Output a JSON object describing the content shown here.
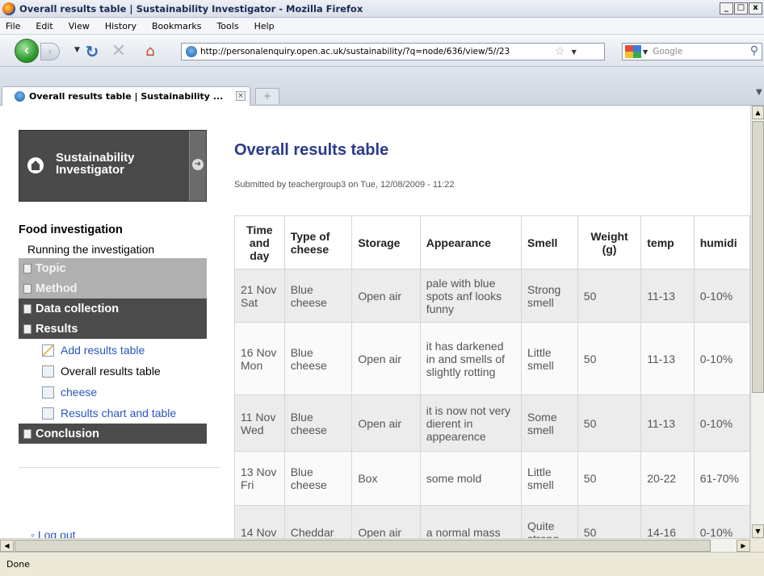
{
  "window": {
    "title": "Overall results table | Sustainability Investigator - Mozilla Firefox",
    "controls": [
      "_",
      "□",
      "x"
    ]
  },
  "menu": [
    "File",
    "Edit",
    "View",
    "History",
    "Bookmarks",
    "Tools",
    "Help"
  ],
  "nav": {
    "url": "http://personalenquiry.open.ac.uk/sustainability/?q=node/636/view/5//23",
    "search_placeholder": "Google"
  },
  "tab": {
    "title": "Overall results table | Sustainability ..."
  },
  "status": "Done",
  "sidebar": {
    "logo_line1": "Sustainability",
    "logo_line2": "Investigator",
    "heading": "Food investigation",
    "subheading": "Running the investigation",
    "items": [
      {
        "label": "Topic"
      },
      {
        "label": "Method"
      },
      {
        "label": "Data collection"
      },
      {
        "label": "Results"
      }
    ],
    "result_links": [
      {
        "label": "Add results table"
      },
      {
        "label": "Overall results table"
      },
      {
        "label": "cheese"
      },
      {
        "label": "Results chart and table"
      }
    ],
    "conclusion": "Conclusion",
    "logout": "Log out"
  },
  "main": {
    "title": "Overall results table",
    "submitted": "Submitted by teachergroup3 on Tue, 12/08/2009 - 11:22",
    "headers": [
      "Time and day",
      "Type of cheese",
      "Storage",
      "Appearance",
      "Smell",
      "Weight (g)",
      "temp",
      "humidi"
    ],
    "rows": [
      {
        "time": "21 Nov Sat",
        "cheese": "Blue cheese",
        "storage": "Open air",
        "appearance": "pale with blue spots anf looks funny",
        "smell": "Strong smell",
        "weight": "50",
        "temp": "11-13",
        "humidity": "0-10%"
      },
      {
        "time": "16 Nov Mon",
        "cheese": "Blue cheese",
        "storage": "Open air",
        "appearance": "it has darkened in and smells of slightly rotting",
        "smell": "Little smell",
        "weight": "50",
        "temp": "11-13",
        "humidity": "0-10%"
      },
      {
        "time": "11 Nov Wed",
        "cheese": "Blue cheese",
        "storage": "Open air",
        "appearance": "it is now not very dierent in appearence",
        "smell": "Some smell",
        "weight": "50",
        "temp": "11-13",
        "humidity": "0-10%"
      },
      {
        "time": "13 Nov Fri",
        "cheese": "Blue cheese",
        "storage": "Box",
        "appearance": "some mold",
        "smell": "Little smell",
        "weight": "50",
        "temp": "20-22",
        "humidity": "61-70%"
      },
      {
        "time": "14 Nov",
        "cheese": "Cheddar",
        "storage": "Open air",
        "appearance": "a normal mass",
        "smell": "Quite strong",
        "weight": "50",
        "temp": "14-16",
        "humidity": "0-10%"
      }
    ]
  }
}
